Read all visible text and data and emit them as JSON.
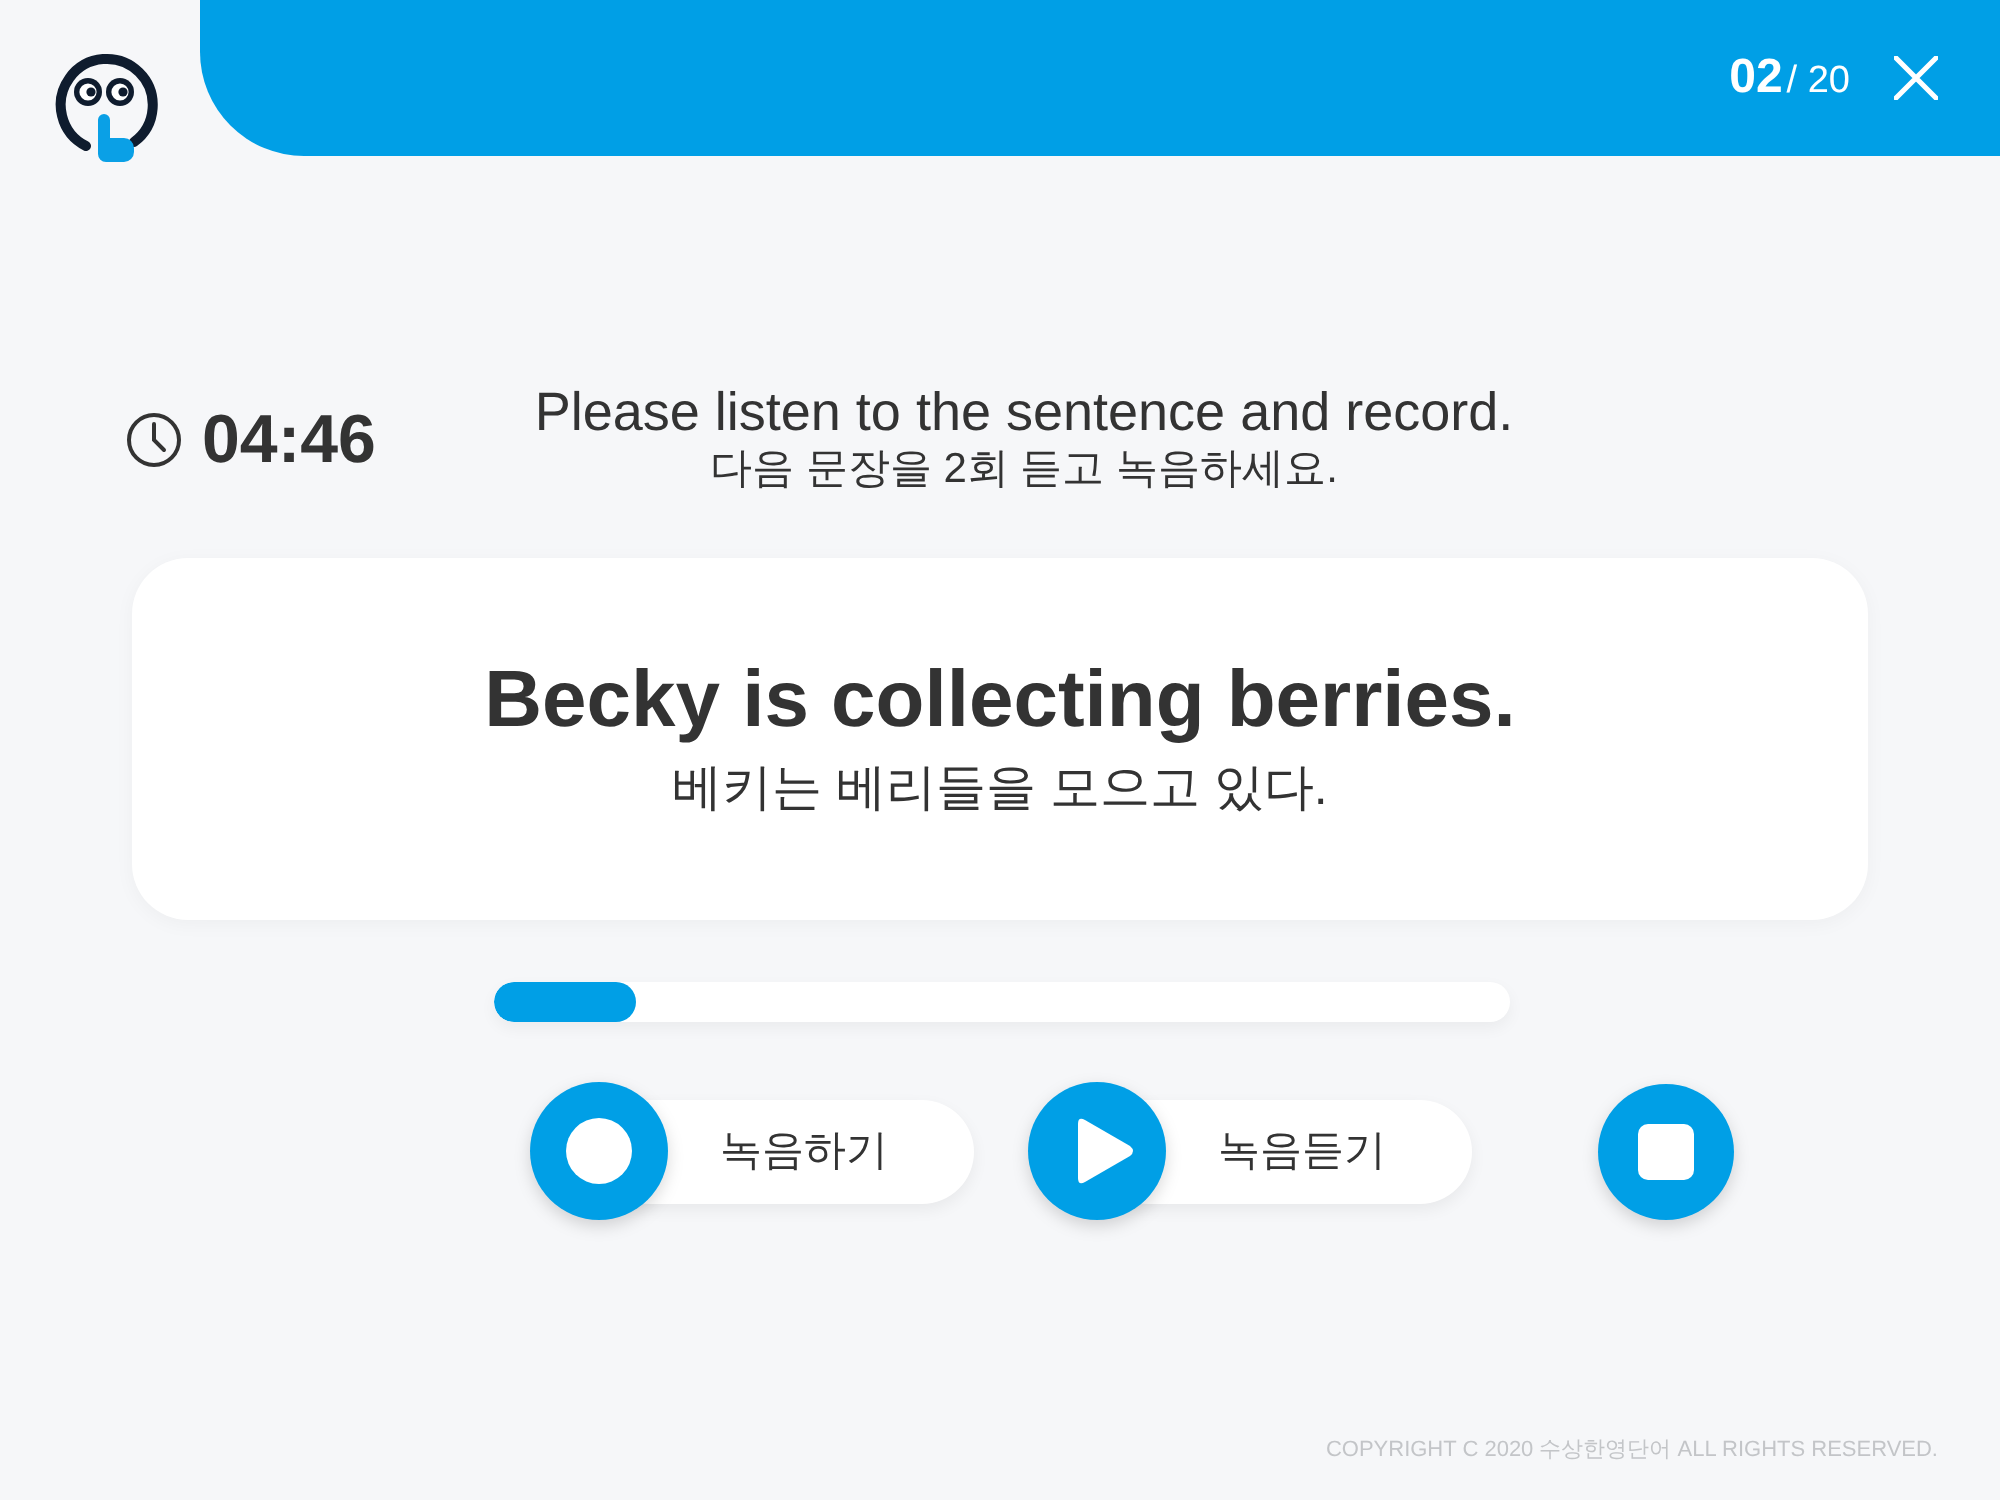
{
  "header": {
    "current": "02",
    "total": "/ 20"
  },
  "timer": {
    "time": "04:46"
  },
  "instruction": {
    "english": "Please listen to the sentence and record.",
    "korean": "다음 문장을 2회 듣고 녹음하세요."
  },
  "card": {
    "sentence": "Becky is collecting berries.",
    "translation": "베키는 베리들을 모으고 있다."
  },
  "progress": {
    "level": 0.14
  },
  "controls": [
    {
      "kind": "record",
      "label": "녹음하기"
    },
    {
      "kind": "listen",
      "label": "녹음듣기"
    },
    {
      "kind": "stop"
    }
  ],
  "footer": {
    "copyright": "COPYRIGHT C 2020 수상한영단어 ALL RIGHTS RESERVED."
  }
}
